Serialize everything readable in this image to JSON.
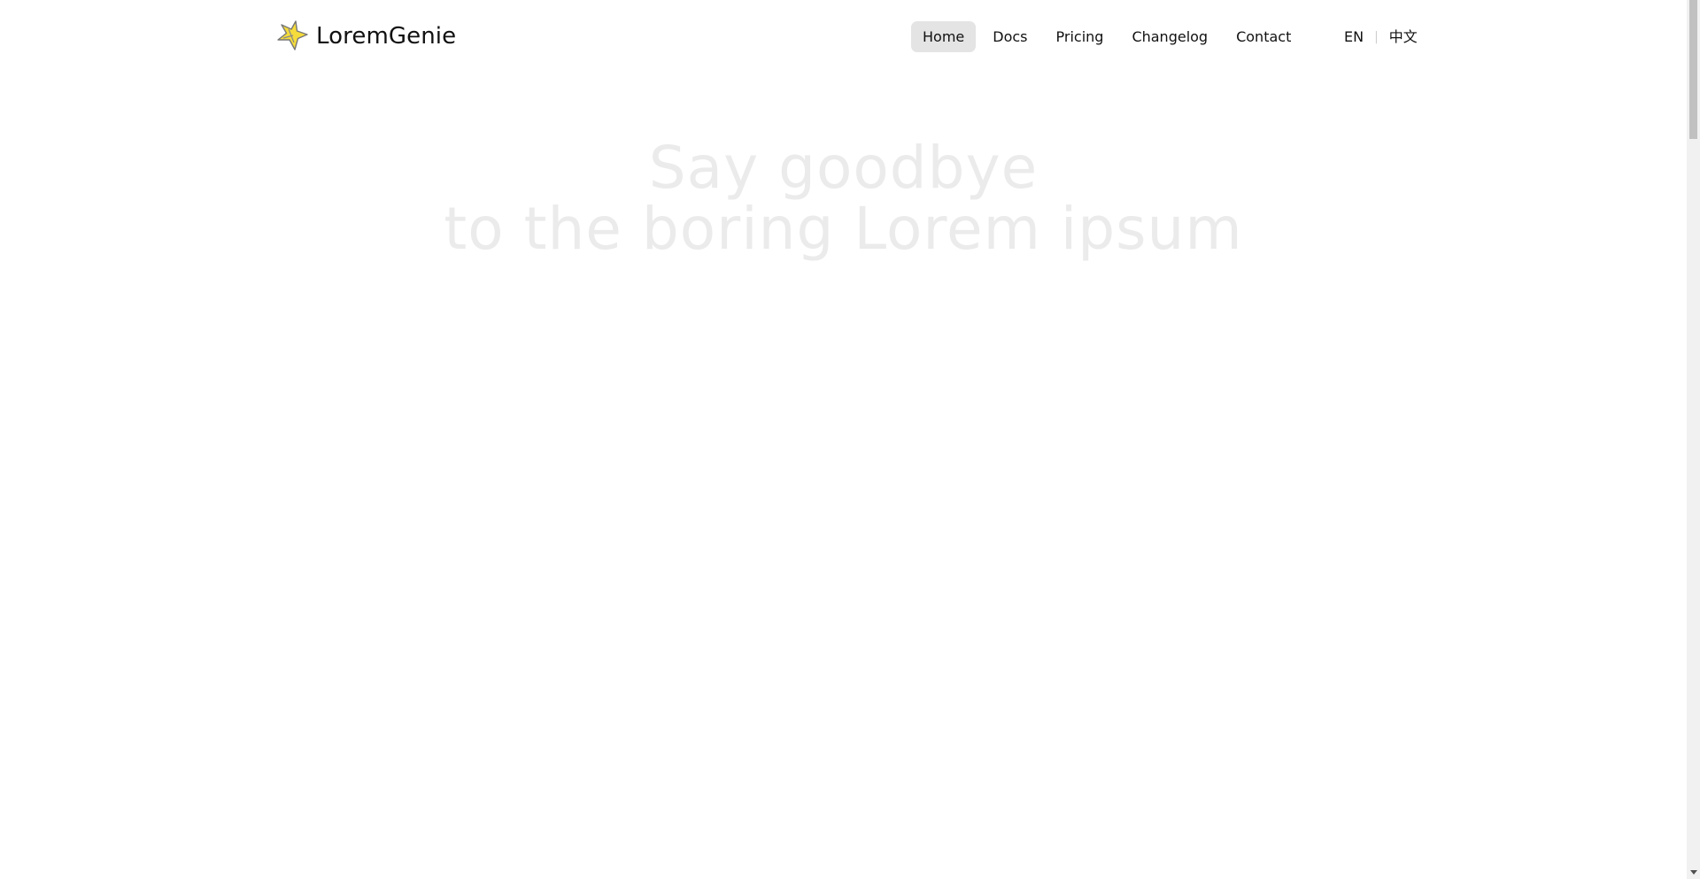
{
  "brand": {
    "name": "LoremGenie",
    "logo_icon": "star-icon",
    "logo_color": "#f5dc3c"
  },
  "nav": {
    "items": [
      {
        "label": "Home",
        "active": true
      },
      {
        "label": "Docs",
        "active": false
      },
      {
        "label": "Pricing",
        "active": false
      },
      {
        "label": "Changelog",
        "active": false
      },
      {
        "label": "Contact",
        "active": false
      }
    ]
  },
  "language": {
    "current": "EN",
    "alternate": "中文",
    "separator": "|"
  },
  "hero": {
    "line1": "Say goodbye",
    "line2": "to the boring Lorem ipsum",
    "color": "#ebebeb"
  },
  "colors": {
    "active_nav_bg": "#e4e4e4",
    "text": "#111111"
  }
}
